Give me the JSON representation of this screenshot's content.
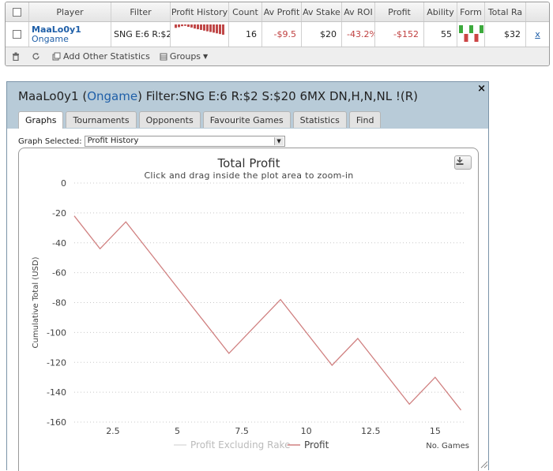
{
  "stats_table": {
    "columns": [
      "Player",
      "Filter",
      "Profit History",
      "Count",
      "Av Profit",
      "Av Stake",
      "Av ROI",
      "Profit",
      "Ability",
      "Form",
      "Total Ra"
    ],
    "row": {
      "player_name": "MaaLo0y1",
      "player_site": "Ongame",
      "filter": "SNG E:6 R:$2",
      "count": "16",
      "av_profit": "-$9.5",
      "av_stake": "$20",
      "av_roi": "-43.2%",
      "profit": "-$152",
      "ability": "55",
      "total_rake": "$32",
      "remove": "x",
      "profit_history_bars": [
        10,
        8,
        5,
        4,
        7,
        9,
        12,
        14,
        16,
        18,
        20,
        22,
        24,
        26,
        28,
        30
      ],
      "form_bars": [
        {
          "value": 1,
          "color": "#3daa3d"
        },
        {
          "value": -1,
          "color": "#cc4444"
        },
        {
          "value": 1,
          "color": "#3daa3d"
        },
        {
          "value": -1,
          "color": "#cc4444"
        },
        {
          "value": 1,
          "color": "#3daa3d"
        }
      ]
    }
  },
  "toolbar": {
    "add_stats_label": "Add Other Statistics",
    "groups_label": "Groups"
  },
  "graph_window": {
    "title_player": "MaaLo0y1",
    "title_site": "Ongame",
    "title_filter": "Filter:SNG E:6 R:$2 S:$20 6MX DN,H,N,NL !(R)",
    "close_label": "×",
    "tabs": [
      {
        "label": "Graphs",
        "active": true
      },
      {
        "label": "Tournaments",
        "active": false
      },
      {
        "label": "Opponents",
        "active": false
      },
      {
        "label": "Favourite Games",
        "active": false
      },
      {
        "label": "Statistics",
        "active": false
      },
      {
        "label": "Find",
        "active": false
      }
    ],
    "graph_selected_label": "Graph Selected:",
    "graph_selected_value": "Profit History"
  },
  "chart_data": {
    "type": "line",
    "title": "Total Profit",
    "subtitle": "Click and drag inside the plot area to zoom-in",
    "xlabel": "No. Games",
    "ylabel": "Cumulative Total (USD)",
    "xlim": [
      1,
      16.2
    ],
    "ylim": [
      -160,
      0
    ],
    "x_ticks": [
      2.5,
      5,
      7.5,
      10,
      12.5,
      15
    ],
    "y_ticks": [
      0,
      -20,
      -40,
      -60,
      -80,
      -100,
      -120,
      -140,
      -160
    ],
    "grid": true,
    "legend_position": "bottom",
    "series": [
      {
        "name": "Profit Excluding Rake",
        "color": "#dddddd",
        "x": [],
        "y": []
      },
      {
        "name": "Profit",
        "color": "#d08080",
        "x": [
          1,
          2,
          3,
          4,
          5,
          6,
          7,
          8,
          9,
          10,
          11,
          12,
          13,
          14,
          15,
          16
        ],
        "y": [
          -22,
          -44,
          -26,
          -48,
          -70,
          -92,
          -114,
          -96,
          -78,
          -100,
          -122,
          -104,
          -126,
          -148,
          -130,
          -152
        ]
      }
    ]
  }
}
